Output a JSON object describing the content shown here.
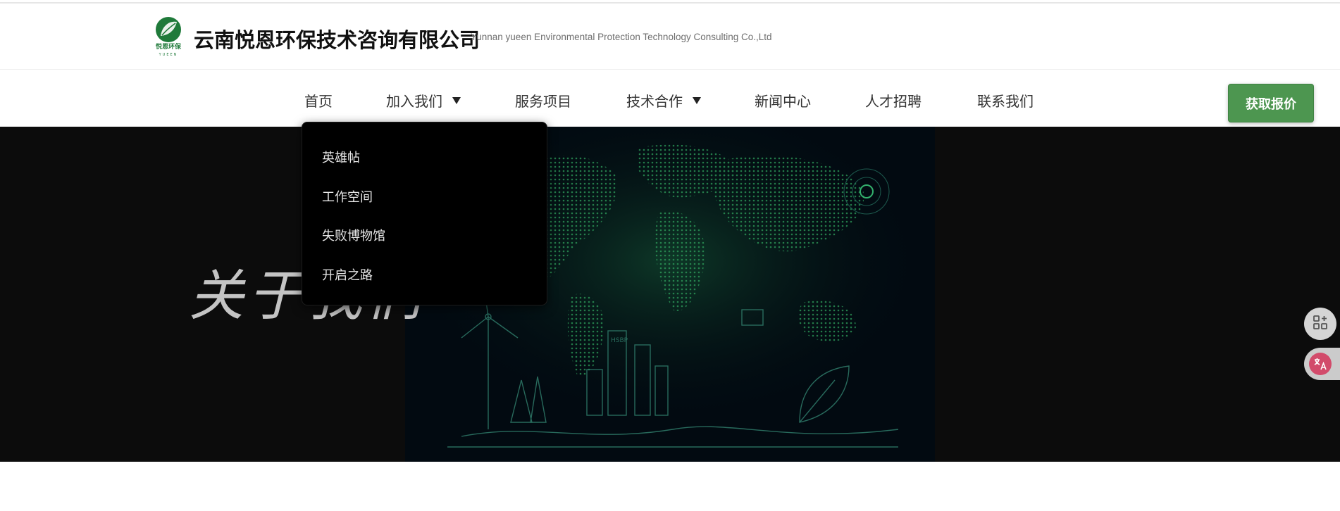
{
  "header": {
    "logo_text": "悦恩环保",
    "logo_subtext": "YUEEN",
    "company_name": "云南悦恩环保技术咨询有限公司",
    "company_name_en": "Yunnan yueen Environmental Protection Technology Consulting Co.,Ltd"
  },
  "nav": {
    "items": [
      {
        "label": "首页"
      },
      {
        "label": "加入我们"
      },
      {
        "label": "服务项目"
      },
      {
        "label": "技术合作"
      },
      {
        "label": "新闻中心"
      },
      {
        "label": "人才招聘"
      },
      {
        "label": "联系我们"
      }
    ],
    "quote_button": "获取报价"
  },
  "dropdown": {
    "items": [
      {
        "label": "英雄帖"
      },
      {
        "label": "工作空间"
      },
      {
        "label": "失败博物馆"
      },
      {
        "label": "开启之路"
      }
    ]
  },
  "hero": {
    "title": "关于我们",
    "art_label": "HSBP"
  },
  "colors": {
    "brand_green": "#4d9650",
    "hero_bg": "#0c0c0c",
    "map_green": "#2e9e5b",
    "translate_pink": "#d24b6b"
  },
  "icons": {
    "apps": "apps-add-icon",
    "translate": "translate-icon",
    "caret": "caret-down-icon"
  }
}
